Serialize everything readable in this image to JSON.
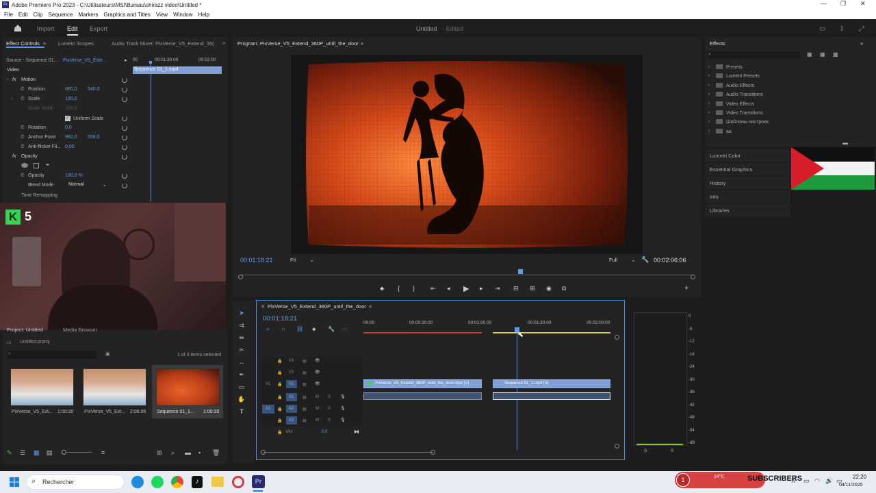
{
  "window": {
    "title": "Adobe Premiere Pro 2023 - C:\\Utilisateurs\\MSI\\Bureau\\shirazz video\\Untitled *"
  },
  "menu": [
    "File",
    "Edit",
    "Clip",
    "Sequence",
    "Markers",
    "Graphics and Titles",
    "View",
    "Window",
    "Help"
  ],
  "topbar": {
    "import": "Import",
    "edit": "Edit",
    "export": "Export",
    "project_name": "Untitled",
    "status": "- Edited"
  },
  "effect_controls": {
    "tabs": [
      "Effect Controls",
      "Lumetri Scopes",
      "Audio Track Mixer: PixVerse_V5_Extend_36("
    ],
    "source": "Source - Sequence 01...",
    "source_clip": "PixVerse_V5_Exte...",
    "timecodes": [
      "00",
      "00:01:30:00",
      "00:02:00"
    ],
    "clip_bar": "Sequence 01_1.mp4",
    "video_label": "Video",
    "motion": "Motion",
    "position": {
      "label": "Position",
      "x": "960,0",
      "y": "540,0"
    },
    "scale": {
      "label": "Scale",
      "value": "100,0"
    },
    "scale_width": {
      "label": "Scale Width",
      "value": "100,0"
    },
    "uniform_scale": "Uniform Scale",
    "rotation": {
      "label": "Rotation",
      "value": "0,0"
    },
    "anchor": {
      "label": "Anchor Point",
      "x": "992,0",
      "y": "558,0"
    },
    "antiflicker": {
      "label": "Anti-flicker Fil...",
      "value": "0,00"
    },
    "opacity_section": "Opacity",
    "opacity": {
      "label": "Opacity",
      "value": "100,0 %"
    },
    "blend": {
      "label": "Blend Mode",
      "value": "Normal"
    },
    "time_remap": "Time Remapping"
  },
  "webcam": {
    "badge": "5"
  },
  "project": {
    "tabs": [
      "Project: Untitled",
      "Media Browser"
    ],
    "file": "Untitled.prproj",
    "count": "1 of 3 items selected",
    "items": [
      {
        "name": "PixVerse_V5_Ext...",
        "duration": "1:00:30"
      },
      {
        "name": "PixVerse_V5_Ext...",
        "duration": "2:06:06"
      },
      {
        "name": "Sequence 01_1...",
        "duration": "1:00:30"
      }
    ]
  },
  "program": {
    "title": "Program: PixVerse_V5_Extend_360P_until_the_door",
    "timecode": "00:01:18:21",
    "fit": "Fit",
    "quality": "Full",
    "duration": "00:02:06:06"
  },
  "timeline": {
    "title": "PixVerse_V5_Extend_360P_until_the_door",
    "timecode": "00:01:18:21",
    "ruler": [
      "00:00",
      "00:00:30:00",
      "00:01:00:00",
      "00:01:30:00",
      "00:02:00:00"
    ],
    "tracks": [
      "V3",
      "V2",
      "V1",
      "A1",
      "A2",
      "A3"
    ],
    "track_targets": {
      "video": "V1",
      "audio": "A1"
    },
    "mix": "Mix",
    "mix_value": "0,0",
    "clip1": "PixVerse_V5_Extend_360P_until_the_door.mp4 [V]",
    "clip2": "Sequence 01_1.mp4 [V]"
  },
  "meter": {
    "scale": [
      "0",
      "-6",
      "-12",
      "-18",
      "-24",
      "-30",
      "-36",
      "-42",
      "-48",
      "-54",
      "-dB"
    ],
    "solo": [
      "S",
      "S"
    ]
  },
  "effects": {
    "title": "Effects",
    "items": [
      "Presets",
      "Lumetri Presets",
      "Audio Effects",
      "Audio Transitions",
      "Video Effects",
      "Video Transitions",
      "Шаблоны настроек",
      "aa"
    ],
    "panels": [
      "Lumetri Color",
      "Essential Graphics",
      "History",
      "Info",
      "Libraries"
    ]
  },
  "taskbar": {
    "search": "Rechercher",
    "weather": "14°C",
    "subscribers": "SUBSCRIBERS",
    "badge": "1",
    "time": "22:20",
    "date": "04/11/2025"
  },
  "colors": {
    "accent": "#5e9bf0",
    "clip": "#7f9fd6",
    "playhead": "#4c8fe6"
  }
}
